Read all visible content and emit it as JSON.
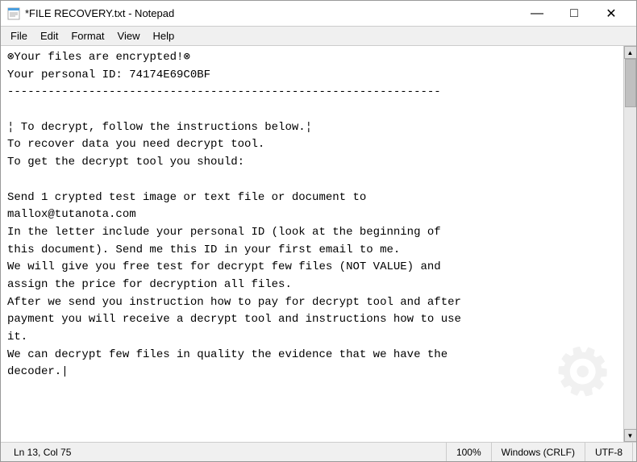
{
  "window": {
    "title": "*FILE RECOVERY.txt - Notepad"
  },
  "titlebar": {
    "icon": "📄",
    "minimize_label": "—",
    "maximize_label": "□",
    "close_label": "✕"
  },
  "menu": {
    "items": [
      "File",
      "Edit",
      "Format",
      "View",
      "Help"
    ]
  },
  "editor": {
    "content": "⊗Your files are encrypted!⊗\nYour personal ID: 74174E69C0BF\n----------------------------------------------------------------\n\n¦ To decrypt, follow the instructions below.¦\nTo recover data you need decrypt tool.\nTo get the decrypt tool you should:\n\nSend 1 crypted test image or text file or document to\nmallox@tutanota.com\nIn the letter include your personal ID (look at the beginning of\nthis document). Send me this ID in your first email to me.\nWe will give you free test for decrypt few files (NOT VALUE) and\nassign the price for decryption all files.\nAfter we send you instruction how to pay for decrypt tool and after\npayment you will receive a decrypt tool and instructions how to use\nit.\nWe can decrypt few files in quality the evidence that we have the\ndecoder.|"
  },
  "statusbar": {
    "position": "Ln 13, Col 75",
    "zoom": "100%",
    "line_ending": "Windows (CRLF)",
    "encoding": "UTF-8"
  }
}
